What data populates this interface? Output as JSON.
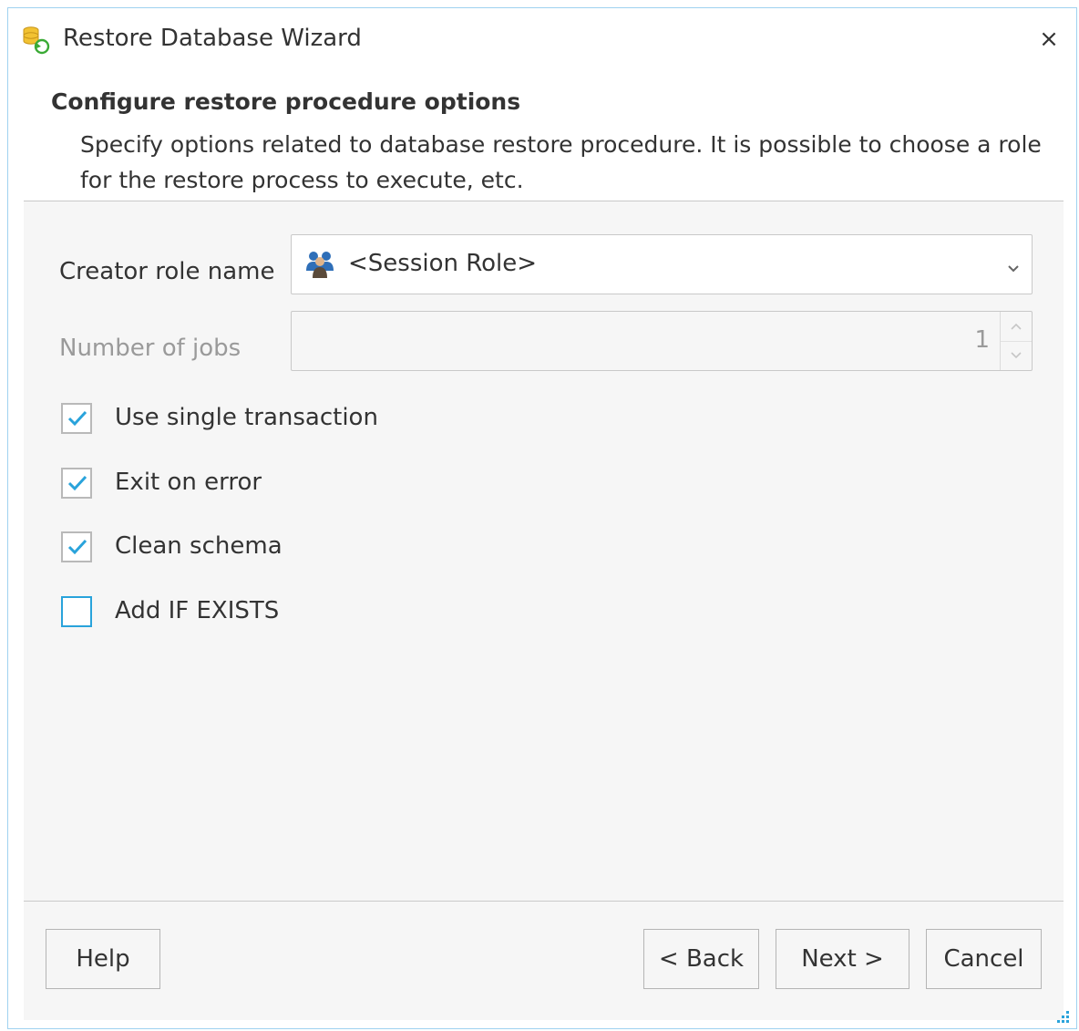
{
  "window": {
    "title": "Restore Database Wizard",
    "close_glyph": "×",
    "icon": "database-restore-icon",
    "border_color": "#9fd2f0"
  },
  "header": {
    "heading": "Configure restore procedure options",
    "description": "Specify options related to database restore procedure. It is possible to choose a role for the restore process to execute, etc."
  },
  "form": {
    "creator_role": {
      "label": "Creator role name",
      "value": "<Session Role>",
      "icon": "group-users-icon"
    },
    "jobs": {
      "label": "Number of jobs",
      "value": "1",
      "disabled": true
    },
    "options": [
      {
        "label": "Use single transaction",
        "checked": true
      },
      {
        "label": "Exit on error",
        "checked": true
      },
      {
        "label": "Clean schema",
        "checked": true
      },
      {
        "label": "Add IF EXISTS",
        "checked": false
      }
    ]
  },
  "footer": {
    "help_label": "Help",
    "back_label": "< Back",
    "next_label": "Next >",
    "cancel_label": "Cancel"
  },
  "colors": {
    "accent": "#29a3db",
    "panel_bg": "#f6f6f6",
    "disabled_text": "#9a9a9a"
  }
}
